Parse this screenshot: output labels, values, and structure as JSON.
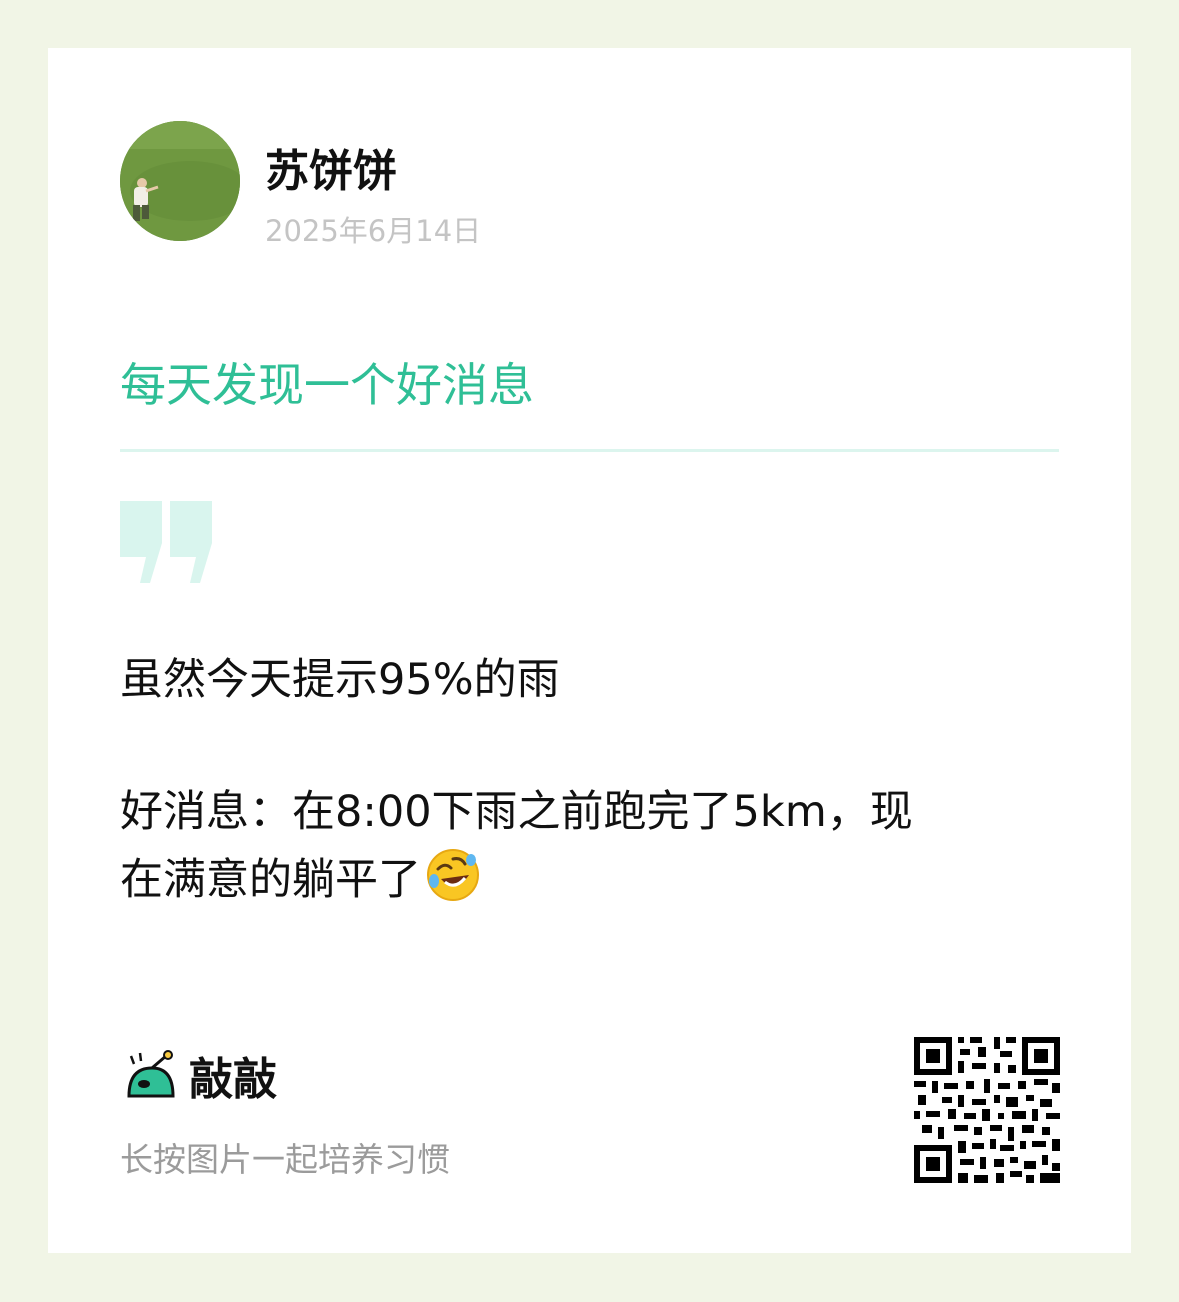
{
  "author": {
    "name": "苏饼饼",
    "date": "2025年6月14日"
  },
  "section": {
    "title": "每天发现一个好消息"
  },
  "post": {
    "line1": "虽然今天提示95%的雨",
    "line2": "好消息：在8:00下雨之前跑完了5km，现",
    "line3": "在满意的躺平了",
    "emoji": "rolling-on-the-floor-laughing-emoji"
  },
  "footer": {
    "brand": "敲敲",
    "note": "长按图片一起培养习惯"
  },
  "colors": {
    "accent": "#2fbf96",
    "quote": "#d9f5ee",
    "page_bg": "#f1f5e6",
    "date": "#c4c4c4",
    "note": "#9b9b9b"
  }
}
